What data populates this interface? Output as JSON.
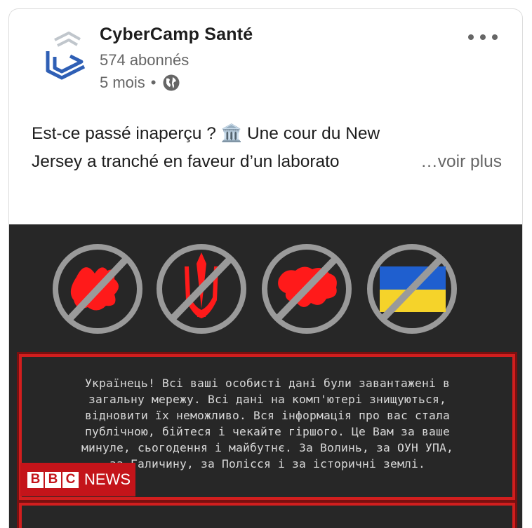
{
  "post": {
    "org_name": "CyberCamp Santé",
    "followers": "574 abonnés",
    "time": "5 mois",
    "separator": "•",
    "visibility_icon": "globe-icon",
    "more_icon": "more-horizontal-icon",
    "text_line1": "Est-ce passé inaperçu ? 🏛️ Une cour du New",
    "text_line2": "Jersey a tranché en faveur d’un laborato",
    "see_more": "…voir plus"
  },
  "image": {
    "icons": [
      "no-symbol-icon",
      "no-trident-icon",
      "no-map-icon",
      "no-flag-icon"
    ],
    "message_lines": [
      "Українець! Всі ваші особисті дані були завантажені в",
      "загальну мережу. Всі дані на комп'ютері знищуються,",
      "відновити їх неможливо. Вся інформація про вас стала",
      "публічною, бійтеся і чекайте гіршого. Це Вам за ваше",
      "минуле, сьогодення і майбутнє. За Волинь, за ОУН УПА,",
      "за Галичину, за Полісся і за історичні землі."
    ],
    "bbc_letters": [
      "B",
      "B",
      "C"
    ],
    "bbc_news": "NEWS"
  },
  "colors": {
    "accent_red": "#d11e1e",
    "flag_blue": "#1f5fcf",
    "flag_yellow": "#f5d32a"
  }
}
